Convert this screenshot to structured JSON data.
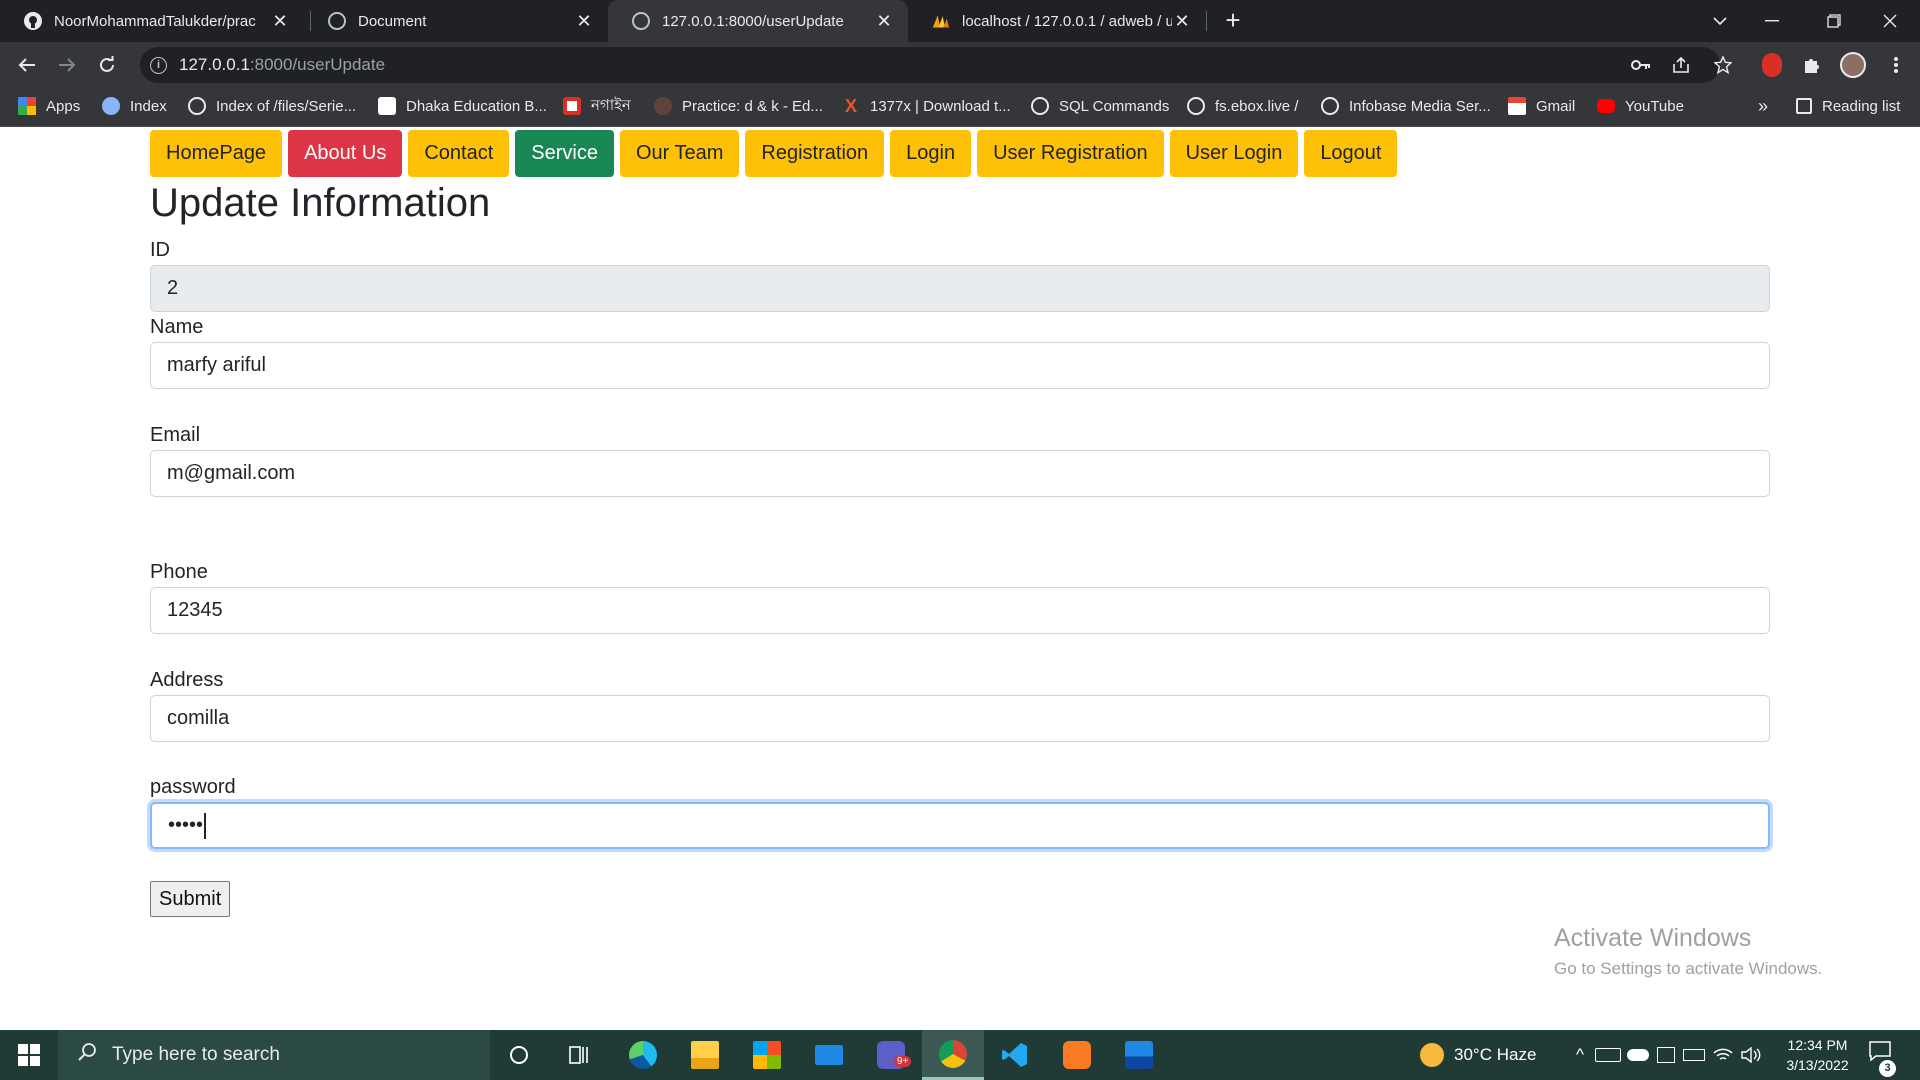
{
  "browser": {
    "tabs": [
      {
        "title": "NoorMohammadTalukder/prac",
        "icon": "github-icon",
        "active": false
      },
      {
        "title": "Document",
        "icon": "globe-icon",
        "active": false
      },
      {
        "title": "127.0.0.1:8000/userUpdate",
        "icon": "globe-icon",
        "active": true
      },
      {
        "title": "localhost / 127.0.0.1 / adweb / us",
        "icon": "phpmyadmin-icon",
        "active": false
      }
    ],
    "close_glyph": "✕",
    "new_tab_glyph": "+",
    "address": {
      "host": "127.0.0.1",
      "path": ":8000/userUpdate"
    },
    "bookmarks": [
      {
        "label": "Apps",
        "icon": "apps-grid-icon"
      },
      {
        "label": "Index",
        "icon": "shield-icon"
      },
      {
        "label": "Index of /files/Serie...",
        "icon": "globe-icon"
      },
      {
        "label": "Dhaka Education B...",
        "icon": "board-logo-icon"
      },
      {
        "label": "নগাইন",
        "icon": "news-icon"
      },
      {
        "label": "Practice: d & k - Ed...",
        "icon": "ninja-icon"
      },
      {
        "label": "1377x | Download t...",
        "icon": "x-logo-icon"
      },
      {
        "label": "SQL Commands",
        "icon": "globe-icon"
      },
      {
        "label": "fs.ebox.live /",
        "icon": "globe-icon"
      },
      {
        "label": "Infobase Media Ser...",
        "icon": "globe-icon"
      },
      {
        "label": "Gmail",
        "icon": "gmail-icon"
      },
      {
        "label": "YouTube",
        "icon": "youtube-icon"
      }
    ],
    "more_bookmarks": "»",
    "reading_list": "Reading list"
  },
  "page": {
    "nav": [
      {
        "label": "HomePage",
        "style": "warning"
      },
      {
        "label": "About Us",
        "style": "danger"
      },
      {
        "label": "Contact",
        "style": "warning"
      },
      {
        "label": "Service",
        "style": "success"
      },
      {
        "label": "Our Team",
        "style": "warning"
      },
      {
        "label": "Registration",
        "style": "warning"
      },
      {
        "label": "Login",
        "style": "warning"
      },
      {
        "label": "User Registration",
        "style": "warning"
      },
      {
        "label": "User Login",
        "style": "warning"
      },
      {
        "label": "Logout",
        "style": "warning"
      }
    ],
    "heading": "Update Information",
    "form": {
      "id_label": "ID",
      "id_value": "2",
      "name_label": "Name",
      "name_value": "marfy ariful",
      "email_label": "Email",
      "email_value": "m@gmail.com",
      "phone_label": "Phone",
      "phone_value": "12345",
      "address_label": "Address",
      "address_value": "comilla",
      "password_label": "password",
      "password_value": "•••••",
      "submit_label": "Submit"
    },
    "watermark": {
      "title": "Activate Windows",
      "subtitle": "Go to Settings to activate Windows."
    }
  },
  "taskbar": {
    "search_placeholder": "Type here to search",
    "apps": [
      "cortana-icon",
      "task-view-icon",
      "edge-icon",
      "file-explorer-icon",
      "store-icon",
      "mail-icon",
      "teams-icon",
      "chrome-icon",
      "vscode-icon",
      "xampp-icon",
      "photos-icon"
    ],
    "teams_badge": "9+",
    "weather": "30°C  Haze",
    "time": "12:34 PM",
    "date": "3/13/2022",
    "notification_count": "3"
  },
  "colors": {
    "warning": "#ffc107",
    "danger": "#dc3545",
    "success": "#198754",
    "chrome_dark": "#202124",
    "chrome_toolbar": "#35363a",
    "taskbar": "#203b36"
  }
}
